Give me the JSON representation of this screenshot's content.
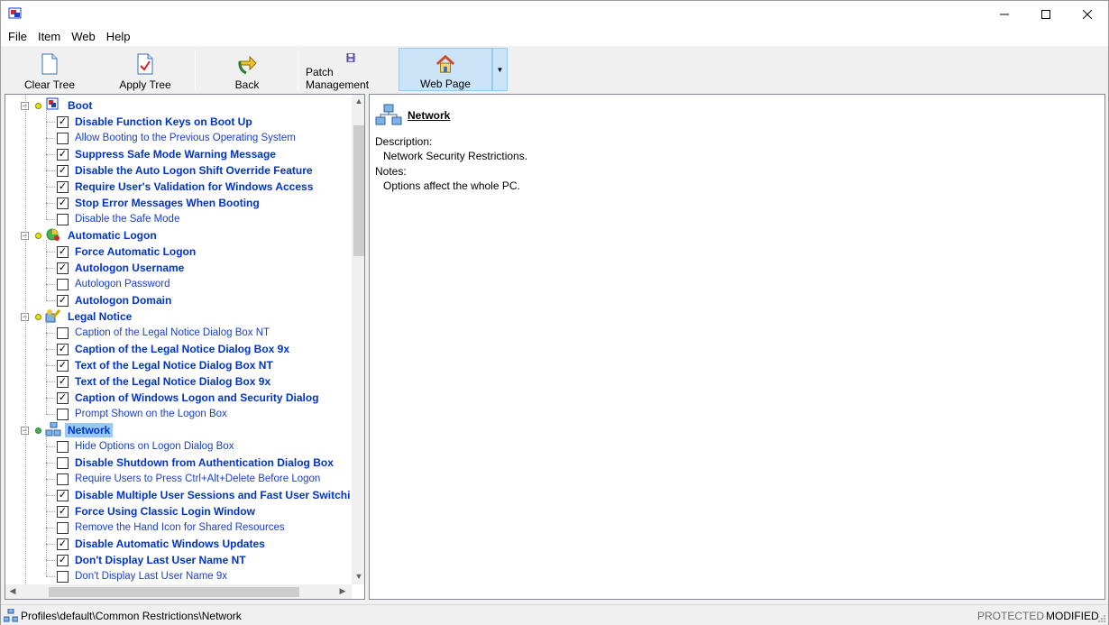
{
  "menu": [
    "File",
    "Item",
    "Web",
    "Help"
  ],
  "toolbar": {
    "clear_tree": "Clear Tree",
    "apply_tree": "Apply Tree",
    "back": "Back",
    "patch_management": "Patch Management",
    "web_page": "Web Page"
  },
  "tree": {
    "categories": [
      {
        "label": "Boot",
        "icon": "boot-icon",
        "items": [
          {
            "label": "Disable Function Keys on Boot Up",
            "checked": true
          },
          {
            "label": "Allow Booting to the Previous Operating System",
            "checked": false
          },
          {
            "label": "Suppress Safe Mode Warning Message",
            "checked": true
          },
          {
            "label": "Disable the Auto Logon Shift Override Feature",
            "checked": true
          },
          {
            "label": "Require User's Validation for Windows Access",
            "checked": true
          },
          {
            "label": "Stop Error Messages When Booting",
            "checked": true
          },
          {
            "label": "Disable the Safe Mode",
            "checked": false
          }
        ]
      },
      {
        "label": "Automatic Logon",
        "icon": "logon-icon",
        "items": [
          {
            "label": "Force Automatic Logon",
            "checked": true
          },
          {
            "label": "Autologon Username",
            "checked": true
          },
          {
            "label": "Autologon Password",
            "checked": false
          },
          {
            "label": "Autologon Domain",
            "checked": true
          }
        ]
      },
      {
        "label": "Legal Notice",
        "icon": "legal-notice-icon",
        "items": [
          {
            "label": "Caption of the Legal Notice Dialog Box NT",
            "checked": false
          },
          {
            "label": "Caption of the Legal Notice Dialog Box 9x",
            "checked": true
          },
          {
            "label": "Text of the Legal Notice Dialog Box NT",
            "checked": true
          },
          {
            "label": "Text of the Legal Notice Dialog Box 9x",
            "checked": true
          },
          {
            "label": "Caption of Windows Logon and Security Dialog",
            "checked": true
          },
          {
            "label": "Prompt Shown on the Logon Box",
            "checked": false
          }
        ]
      },
      {
        "label": "Network",
        "icon": "network-icon",
        "selected": true,
        "items": [
          {
            "label": "Hide Options on Logon Dialog Box",
            "checked": false
          },
          {
            "label": "Disable Shutdown from Authentication Dialog Box",
            "checked": false
          },
          {
            "label": "Require Users to Press Ctrl+Alt+Delete Before Logon",
            "checked": false
          },
          {
            "label": "Disable Multiple User Sessions and Fast User Switchi",
            "checked": true
          },
          {
            "label": "Force Using Classic Login Window",
            "checked": true
          },
          {
            "label": "Remove the Hand Icon for Shared Resources",
            "checked": false
          },
          {
            "label": "Disable Automatic Windows Updates",
            "checked": true
          },
          {
            "label": "Don't Display Last User Name NT",
            "checked": true
          },
          {
            "label": "Don't Display Last User Name 9x",
            "checked": false
          }
        ]
      }
    ]
  },
  "detail": {
    "title": "Network",
    "description_label": "Description:",
    "description": "Network Security Restrictions.",
    "notes_label": "Notes:",
    "notes": "Options affect the whole PC."
  },
  "status": {
    "path": "Profiles\\default\\Common Restrictions\\Network",
    "protected": "PROTECTED",
    "modified": "MODIFIED"
  }
}
